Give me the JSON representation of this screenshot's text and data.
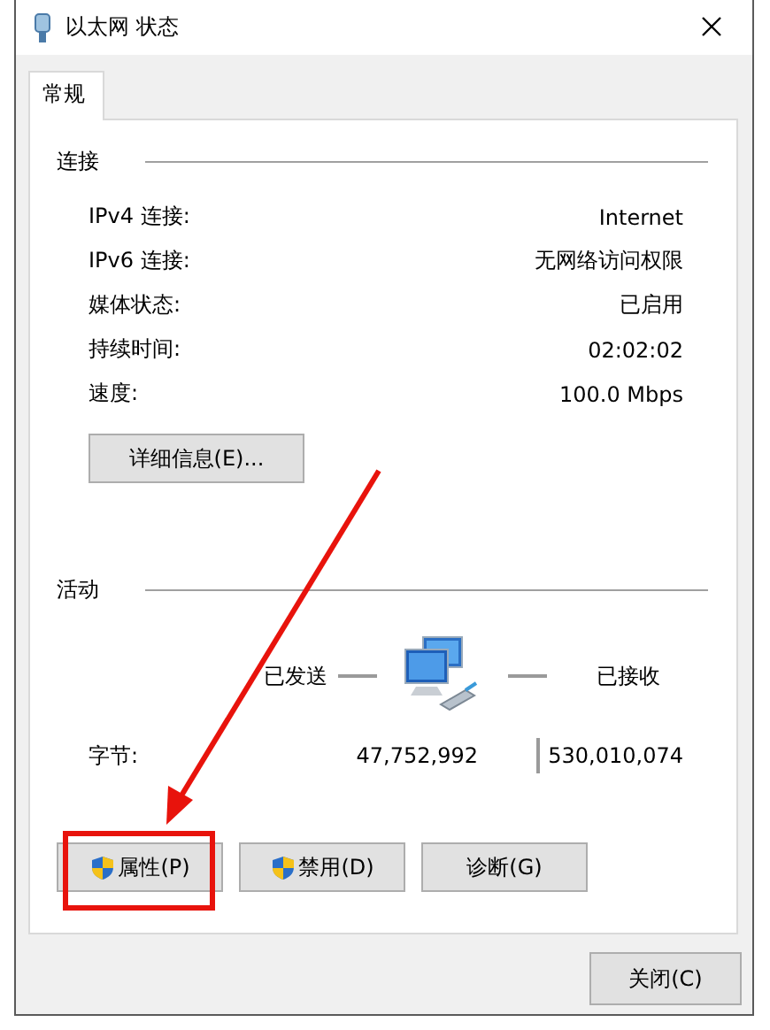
{
  "window": {
    "title": "以太网 状态"
  },
  "tabs": [
    {
      "label": "常规",
      "selected": true
    }
  ],
  "connection": {
    "heading": "连接",
    "rows": [
      {
        "label": "IPv4 连接:",
        "value": "Internet"
      },
      {
        "label": "IPv6 连接:",
        "value": "无网络访问权限"
      },
      {
        "label": "媒体状态:",
        "value": "已启用"
      },
      {
        "label": "持续时间:",
        "value": "02:02:02"
      },
      {
        "label": "速度:",
        "value": "100.0 Mbps"
      }
    ],
    "details_button": "详细信息(E)..."
  },
  "activity": {
    "heading": "活动",
    "sent_label": "已发送",
    "received_label": "已接收",
    "rows": [
      {
        "label": "字节:",
        "sent": "47,752,992",
        "received": "530,010,074"
      }
    ]
  },
  "actions": [
    {
      "label": "属性(P)",
      "shield": true
    },
    {
      "label": "禁用(D)",
      "shield": true
    },
    {
      "label": "诊断(G)",
      "shield": false
    }
  ],
  "close_button": "关闭(C)"
}
